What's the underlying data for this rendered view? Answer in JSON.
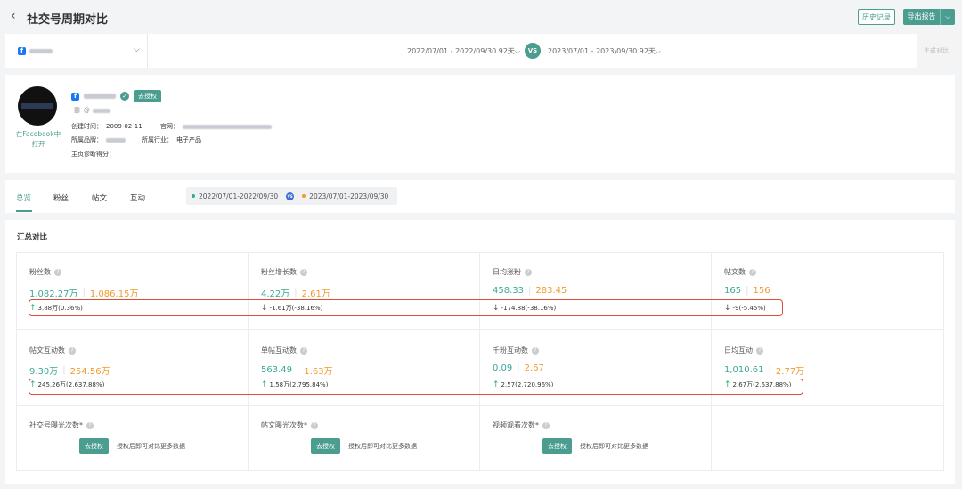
{
  "header": {
    "back_icon": "‹",
    "title": "社交号周期对比",
    "history_label": "历史记录",
    "export_label": "导出报告",
    "export_dropdown": "⌵"
  },
  "selector": {
    "account_chevron": "⌵",
    "period1": "2022/07/01 - 2022/09/30 92天⌵",
    "vs": "VS",
    "period2": "2023/07/01 - 2023/09/30 92天⌵",
    "generate_label": "生成对比"
  },
  "profile": {
    "open_in_facebook": "在Facebook中打开",
    "reauth_label": "去授权",
    "handle_prefix": "@",
    "created_label": "创建时间：",
    "created_value": "2009-02-11",
    "website_label": "官网：",
    "brand_label": "所属品牌：",
    "industry_label": "所属行业：",
    "industry_value": "电子产品",
    "diag_label": "主页诊断得分："
  },
  "tabs": {
    "items": [
      "总览",
      "粉丝",
      "帖文",
      "互动"
    ],
    "period_a": "2022/07/01-2022/09/30",
    "period_b": "2023/07/01-2023/09/30",
    "dot_a_color": "#3aa898",
    "dot_b_color": "#f09a2a"
  },
  "summary": {
    "title": "汇总对比",
    "metrics": [
      {
        "label": "粉丝数",
        "a": "1,082.27万",
        "b": "1,086.15万",
        "dir": "↑",
        "diff": "3.88万(0.36%)"
      },
      {
        "label": "粉丝增长数",
        "a": "4.22万",
        "b": "2.61万",
        "dir": "↓",
        "diff": "-1.61万(-38.16%)"
      },
      {
        "label": "日均涨粉",
        "a": "458.33",
        "b": "283.45",
        "dir": "↓",
        "diff": "-174.88(-38.16%)"
      },
      {
        "label": "帖文数",
        "a": "165",
        "b": "156",
        "dir": "↓",
        "diff": "-9(-5.45%)"
      },
      {
        "label": "帖文互动数",
        "a": "9.30万",
        "b": "254.56万",
        "dir": "↑",
        "diff": "245.26万(2,637.88%)"
      },
      {
        "label": "单帖互动数",
        "a": "563.49",
        "b": "1.63万",
        "dir": "↑",
        "diff": "1.58万(2,795.84%)"
      },
      {
        "label": "千粉互动数",
        "a": "0.09",
        "b": "2.67",
        "dir": "↑",
        "diff": "2.57(2,720.96%)"
      },
      {
        "label": "日均互动",
        "a": "1,010.61",
        "b": "2.77万",
        "dir": "↑",
        "diff": "2.67万(2,637.88%)"
      }
    ],
    "locked": [
      {
        "label": "社交号曝光次数*",
        "btn": "去授权",
        "tip": "授权后即可对比更多数据"
      },
      {
        "label": "帖文曝光次数*",
        "btn": "去授权",
        "tip": "授权后即可对比更多数据"
      },
      {
        "label": "视频观看次数*",
        "btn": "去授权",
        "tip": "授权后即可对比更多数据"
      }
    ]
  },
  "colors": {
    "accent": "#4a9d8f",
    "value_a": "#3aa898",
    "value_b": "#f09a2a",
    "highlight": "#e14b3b"
  }
}
